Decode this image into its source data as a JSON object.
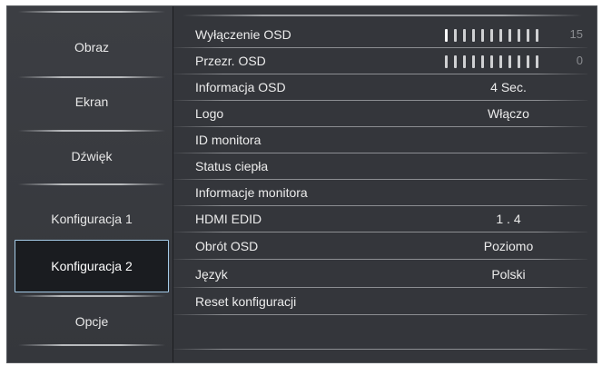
{
  "sidebar": {
    "items": [
      {
        "label": "Obraz",
        "active": false
      },
      {
        "label": "Ekran",
        "active": false
      },
      {
        "label": "Dźwięk",
        "active": false
      },
      {
        "label": "Konfiguracja 1",
        "active": false
      },
      {
        "label": "Konfiguracja 2",
        "active": true
      },
      {
        "label": "Opcje",
        "active": false
      }
    ]
  },
  "settings": {
    "rows": [
      {
        "label": "Wyłączenie OSD",
        "type": "slider",
        "value": 15,
        "ticks_total": 11,
        "ticks_highlighted": 1
      },
      {
        "label": "Przezr. OSD",
        "type": "slider",
        "value": 0,
        "ticks_total": 11,
        "ticks_highlighted": 0
      },
      {
        "label": "Informacja OSD",
        "type": "text",
        "value": "4 Sec."
      },
      {
        "label": "Logo",
        "type": "text",
        "value": "Włączo"
      },
      {
        "label": "ID monitora",
        "type": "none",
        "value": ""
      },
      {
        "label": "Status ciepła",
        "type": "none",
        "value": ""
      },
      {
        "label": "Informacje monitora",
        "type": "none",
        "value": ""
      },
      {
        "label": "HDMI EDID",
        "type": "text",
        "value": "1 . 4"
      },
      {
        "label": "Obrót OSD",
        "type": "text",
        "value": "Poziomo"
      },
      {
        "label": "Język",
        "type": "text",
        "value": "Polski"
      },
      {
        "label": "Reset konfiguracji",
        "type": "none",
        "value": ""
      }
    ]
  },
  "colors": {
    "panel_bg": "#34363b",
    "selected_bg": "#1a1c20",
    "selected_border": "#a5cbe8",
    "text": "#ececec",
    "slider_number": "#8a8c90"
  }
}
